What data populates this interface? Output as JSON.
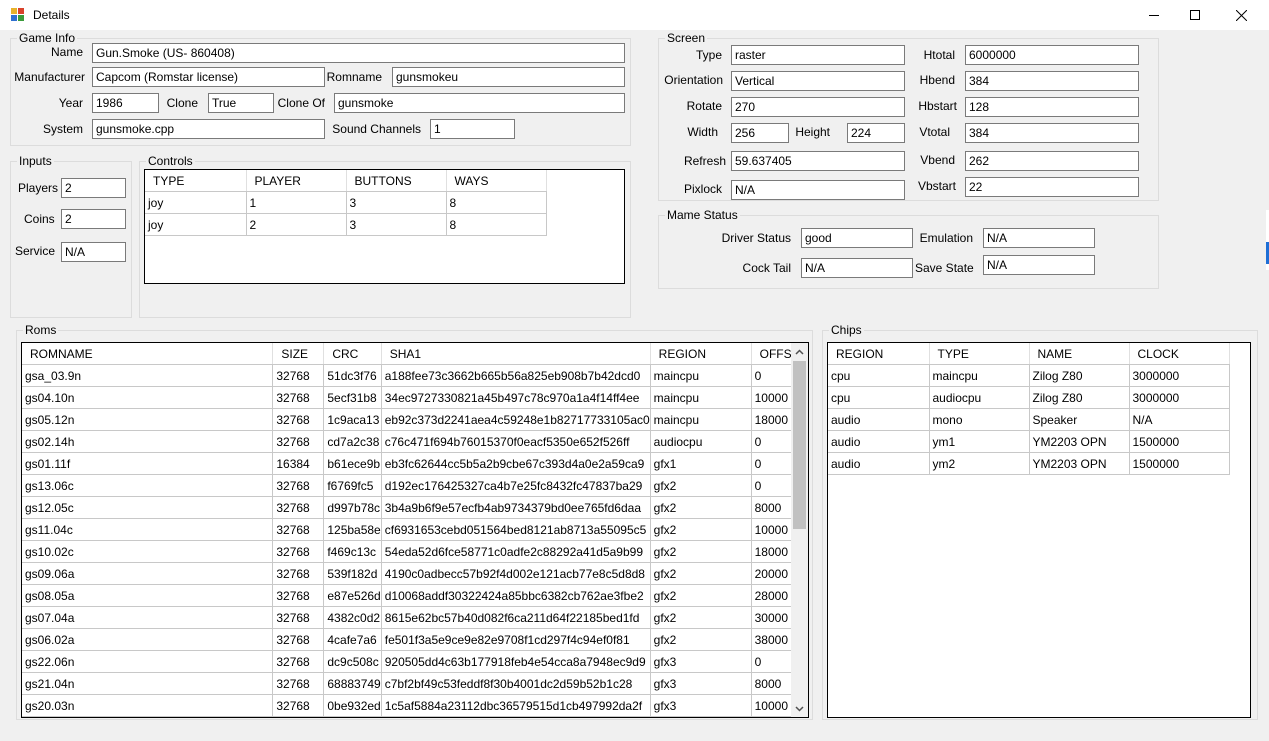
{
  "window": {
    "title": "Details"
  },
  "game_info": {
    "title": "Game Info",
    "name_label": "Name",
    "name": "Gun.Smoke (US- 860408)",
    "manufacturer_label": "Manufacturer",
    "manufacturer": "Capcom (Romstar license)",
    "romname_label": "Romname",
    "romname": "gunsmokeu",
    "year_label": "Year",
    "year": "1986",
    "clone_label": "Clone",
    "clone": "True",
    "clone_of_label": "Clone Of",
    "clone_of": "gunsmoke",
    "system_label": "System",
    "system": "gunsmoke.cpp",
    "sound_channels_label": "Sound Channels",
    "sound_channels": "1"
  },
  "screen": {
    "title": "Screen",
    "type_label": "Type",
    "type": "raster",
    "orientation_label": "Orientation",
    "orientation": "Vertical",
    "rotate_label": "Rotate",
    "rotate": "270",
    "width_label": "Width",
    "width": "256",
    "height_label": "Height",
    "height": "224",
    "refresh_label": "Refresh",
    "refresh": "59.637405",
    "pixlock_label": "Pixlock",
    "pixlock": "N/A",
    "htotal_label": "Htotal",
    "htotal": "6000000",
    "hbend_label": "Hbend",
    "hbend": "384",
    "hbstart_label": "Hbstart",
    "hbstart": "128",
    "vtotal_label": "Vtotal",
    "vtotal": "384",
    "vbend_label": "Vbend",
    "vbend": "262",
    "vbstart_label": "Vbstart",
    "vbstart": "22"
  },
  "inputs": {
    "title": "Inputs",
    "players_label": "Players",
    "players": "2",
    "coins_label": "Coins",
    "coins": "2",
    "service_label": "Service",
    "service": "N/A"
  },
  "controls": {
    "title": "Controls",
    "columns": [
      "TYPE",
      "PLAYER",
      "BUTTONS",
      "WAYS"
    ],
    "rows": [
      [
        "joy",
        "1",
        "3",
        "8"
      ],
      [
        "joy",
        "2",
        "3",
        "8"
      ]
    ]
  },
  "mame_status": {
    "title": "Mame Status",
    "driver_status_label": "Driver Status",
    "driver_status": "good",
    "emulation_label": "Emulation",
    "emulation": "N/A",
    "cocktail_label": "Cock Tail",
    "cocktail": "N/A",
    "save_state_label": "Save State",
    "save_state": "N/A"
  },
  "roms": {
    "title": "Roms",
    "columns": [
      "ROMNAME",
      "SIZE",
      "CRC",
      "SHA1",
      "REGION",
      "OFFSET"
    ],
    "rows": [
      [
        "gsa_03.9n",
        "32768",
        "51dc3f76",
        "a188fee73c3662b665b56a825eb908b7b42dcd0",
        "maincpu",
        "0"
      ],
      [
        "gs04.10n",
        "32768",
        "5ecf31b8",
        "34ec9727330821a45b497c78c970a1a4f14ff4ee",
        "maincpu",
        "10000"
      ],
      [
        "gs05.12n",
        "32768",
        "1c9aca13",
        "eb92c373d2241aea4c59248e1b82717733105ac0",
        "maincpu",
        "18000"
      ],
      [
        "gs02.14h",
        "32768",
        "cd7a2c38",
        "c76c471f694b76015370f0eacf5350e652f526ff",
        "audiocpu",
        "0"
      ],
      [
        "gs01.11f",
        "16384",
        "b61ece9b",
        "eb3fc62644cc5b5a2b9cbe67c393d4a0e2a59ca9",
        "gfx1",
        "0"
      ],
      [
        "gs13.06c",
        "32768",
        "f6769fc5",
        "d192ec176425327ca4b7e25fc8432fc47837ba29",
        "gfx2",
        "0"
      ],
      [
        "gs12.05c",
        "32768",
        "d997b78c",
        "3b4a9b6f9e57ecfb4ab9734379bd0ee765fd6daa",
        "gfx2",
        "8000"
      ],
      [
        "gs11.04c",
        "32768",
        "125ba58e",
        "cf6931653cebd051564bed8121ab8713a55095c5",
        "gfx2",
        "10000"
      ],
      [
        "gs10.02c",
        "32768",
        "f469c13c",
        "54eda52d6fce58771c0adfe2c88292a41d5a9b99",
        "gfx2",
        "18000"
      ],
      [
        "gs09.06a",
        "32768",
        "539f182d",
        "4190c0adbecc57b92f4d002e121acb77e8c5d8d8",
        "gfx2",
        "20000"
      ],
      [
        "gs08.05a",
        "32768",
        "e87e526d",
        "d10068addf30322424a85bbc6382cb762ae3fbe2",
        "gfx2",
        "28000"
      ],
      [
        "gs07.04a",
        "32768",
        "4382c0d2",
        "8615e62bc57b40d082f6ca211d64f22185bed1fd",
        "gfx2",
        "30000"
      ],
      [
        "gs06.02a",
        "32768",
        "4cafe7a6",
        "fe501f3a5e9ce9e82e9708f1cd297f4c94ef0f81",
        "gfx2",
        "38000"
      ],
      [
        "gs22.06n",
        "32768",
        "dc9c508c",
        "920505dd4c63b177918feb4e54cca8a7948ec9d9",
        "gfx3",
        "0"
      ],
      [
        "gs21.04n",
        "32768",
        "68883749",
        "c7bf2bf49c53feddf8f30b4001dc2d59b52b1c28",
        "gfx3",
        "8000"
      ],
      [
        "gs20.03n",
        "32768",
        "0be932ed",
        "1c5af5884a23112dbc36579515d1cb497992da2f",
        "gfx3",
        "10000"
      ]
    ]
  },
  "chips": {
    "title": "Chips",
    "columns": [
      "REGION",
      "TYPE",
      "NAME",
      "CLOCK"
    ],
    "rows": [
      [
        "cpu",
        "maincpu",
        "Zilog Z80",
        "3000000"
      ],
      [
        "cpu",
        "audiocpu",
        "Zilog Z80",
        "3000000"
      ],
      [
        "audio",
        "mono",
        "Speaker",
        "N/A"
      ],
      [
        "audio",
        "ym1",
        "YM2203 OPN",
        "1500000"
      ],
      [
        "audio",
        "ym2",
        "YM2203 OPN",
        "1500000"
      ]
    ]
  }
}
